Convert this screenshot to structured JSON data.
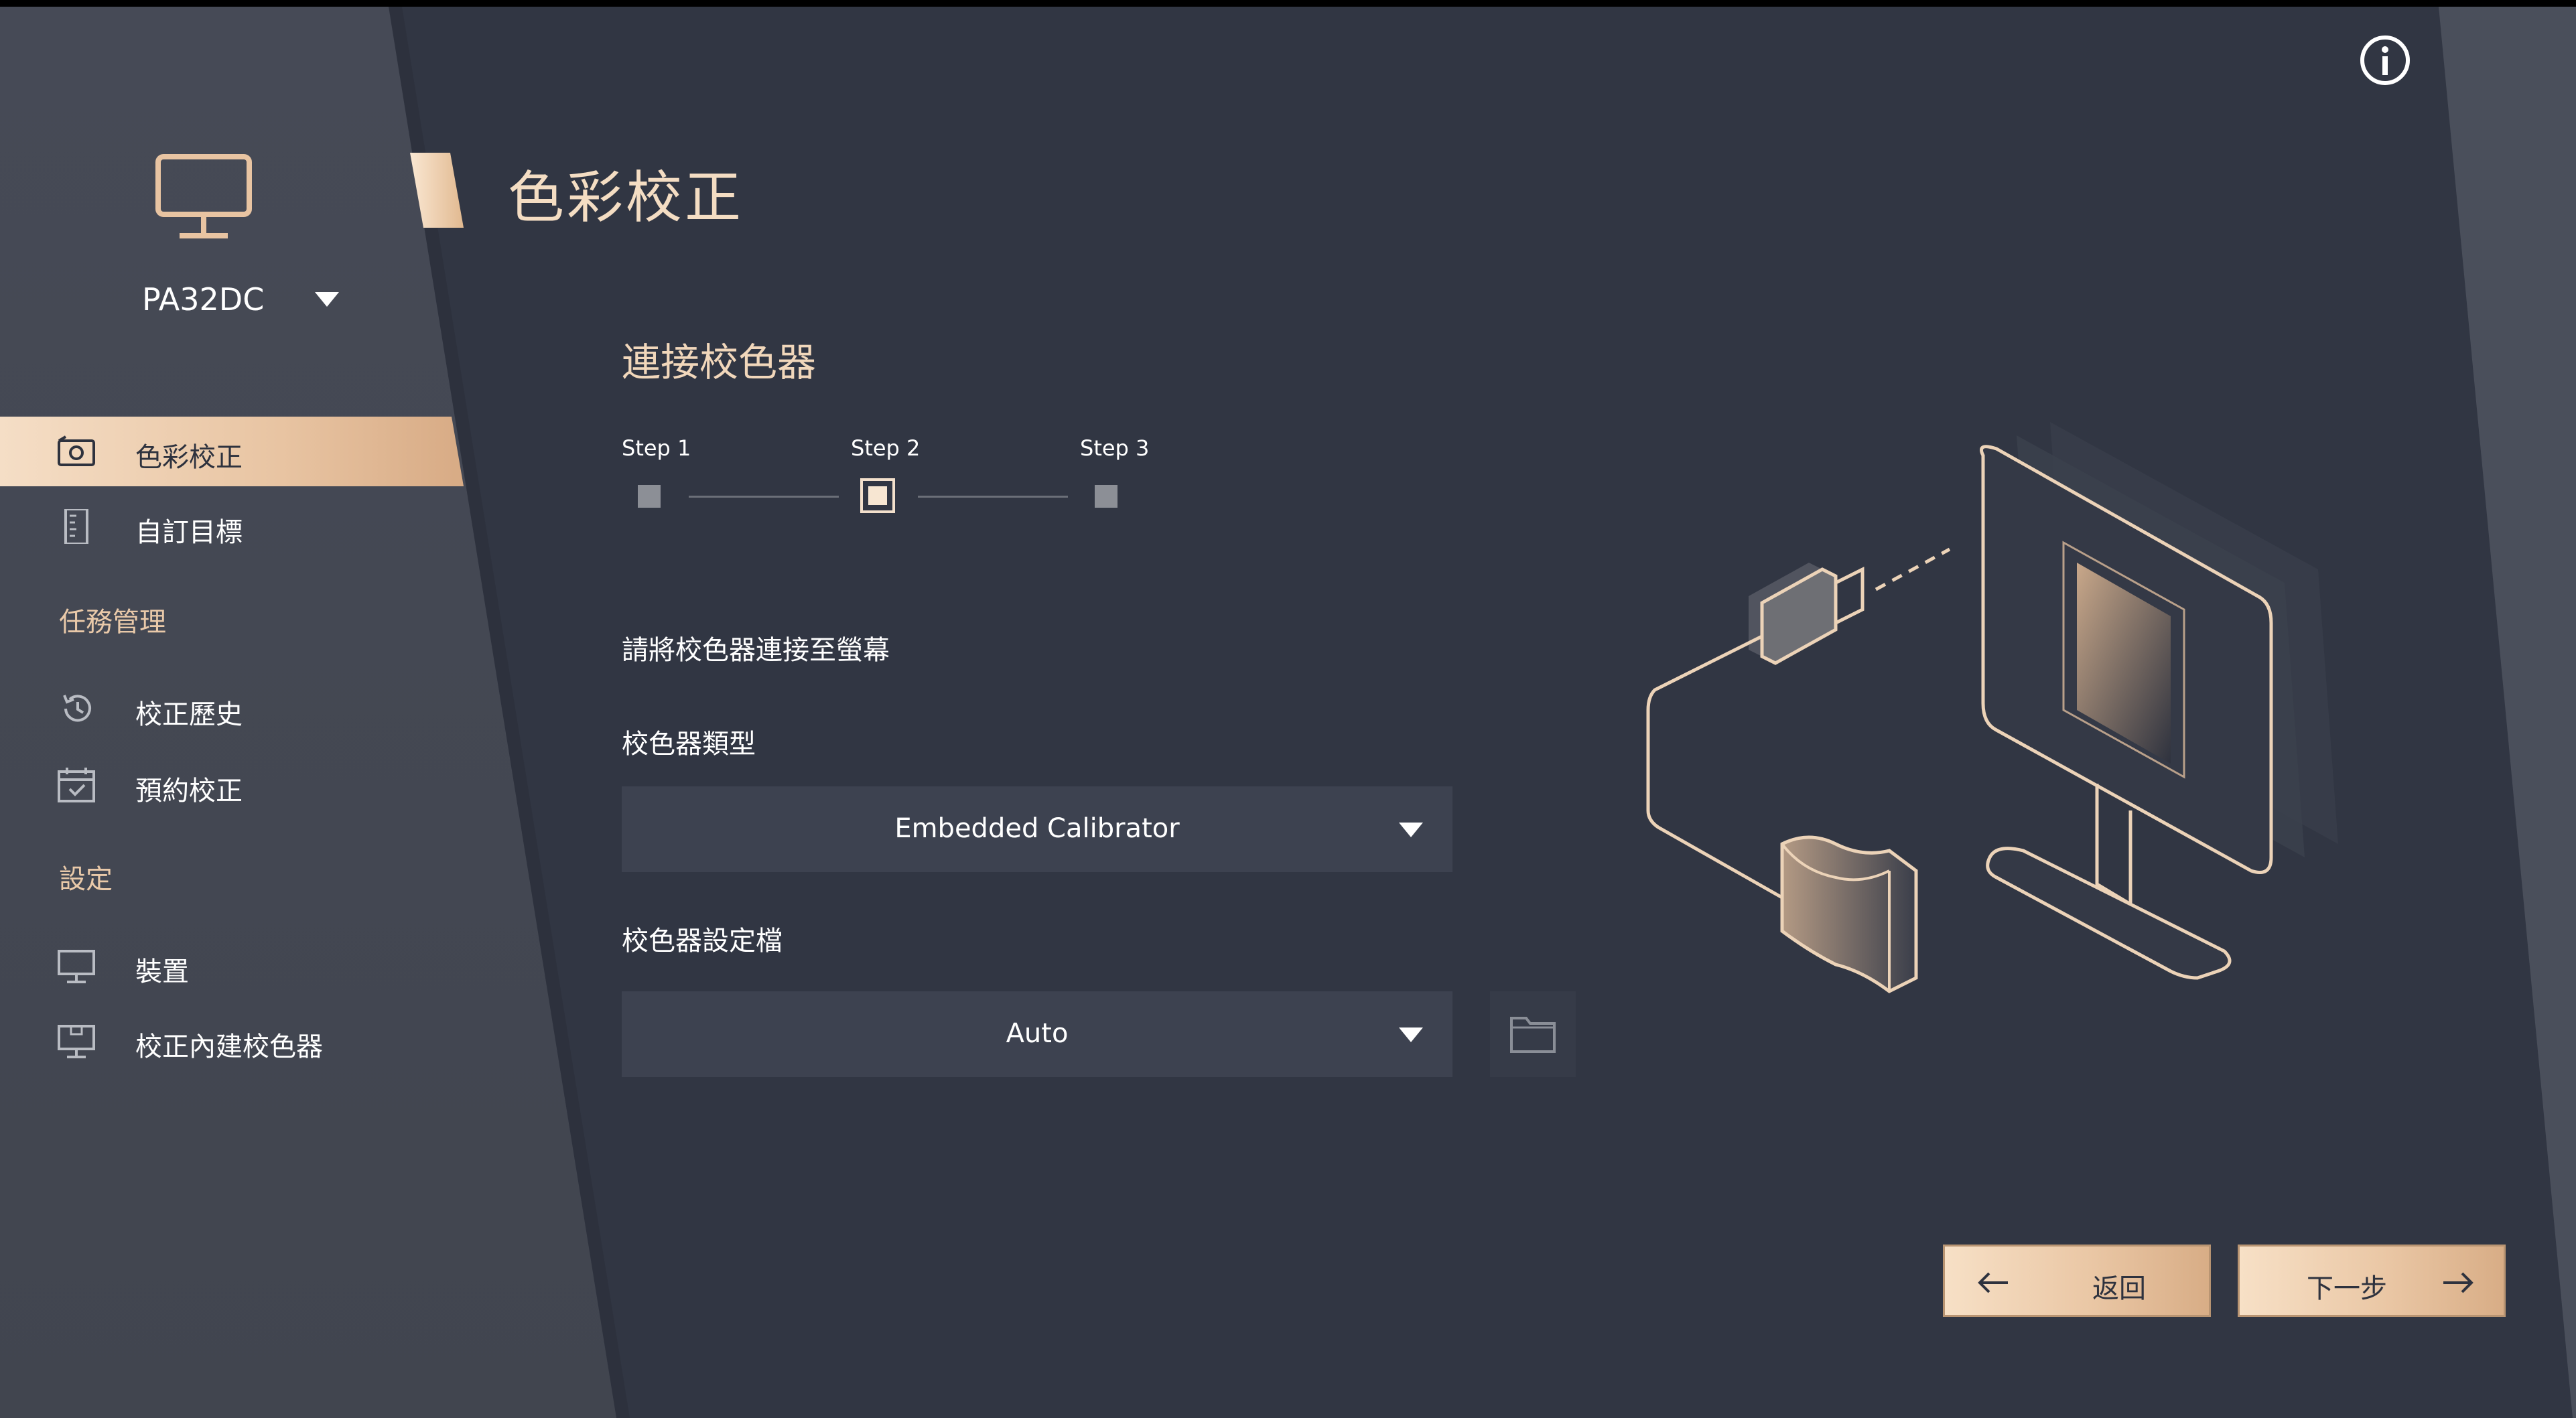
{
  "device": {
    "name": "PA32DC",
    "icon": "monitor-icon"
  },
  "sidebar": {
    "items": [
      {
        "label": "色彩校正",
        "icon": "calibration-icon",
        "active": true
      },
      {
        "label": "自訂目標",
        "icon": "document-ruler-icon",
        "active": false
      }
    ],
    "task_section": "任務管理",
    "task_items": [
      {
        "label": "校正歷史",
        "icon": "history-icon"
      },
      {
        "label": "預約校正",
        "icon": "calendar-check-icon"
      }
    ],
    "settings_section": "設定",
    "settings_items": [
      {
        "label": "裝置",
        "icon": "monitor-icon"
      },
      {
        "label": "校正內建校色器",
        "icon": "monitor-calibrator-icon"
      }
    ]
  },
  "page": {
    "title": "色彩校正",
    "subtitle": "連接校色器",
    "steps": [
      "Step 1",
      "Step 2",
      "Step 3"
    ],
    "active_step": 2,
    "instruction": "請將校色器連接至螢幕",
    "calibrator_type_label": "校色器類型",
    "calibrator_type_value": "Embedded Calibrator",
    "calibrator_profile_label": "校色器設定檔",
    "calibrator_profile_value": "Auto"
  },
  "buttons": {
    "back": "返回",
    "next": "下一步"
  },
  "colors": {
    "accent": "#e8c4a2",
    "background": "#313643",
    "sidebar": "#444853"
  }
}
